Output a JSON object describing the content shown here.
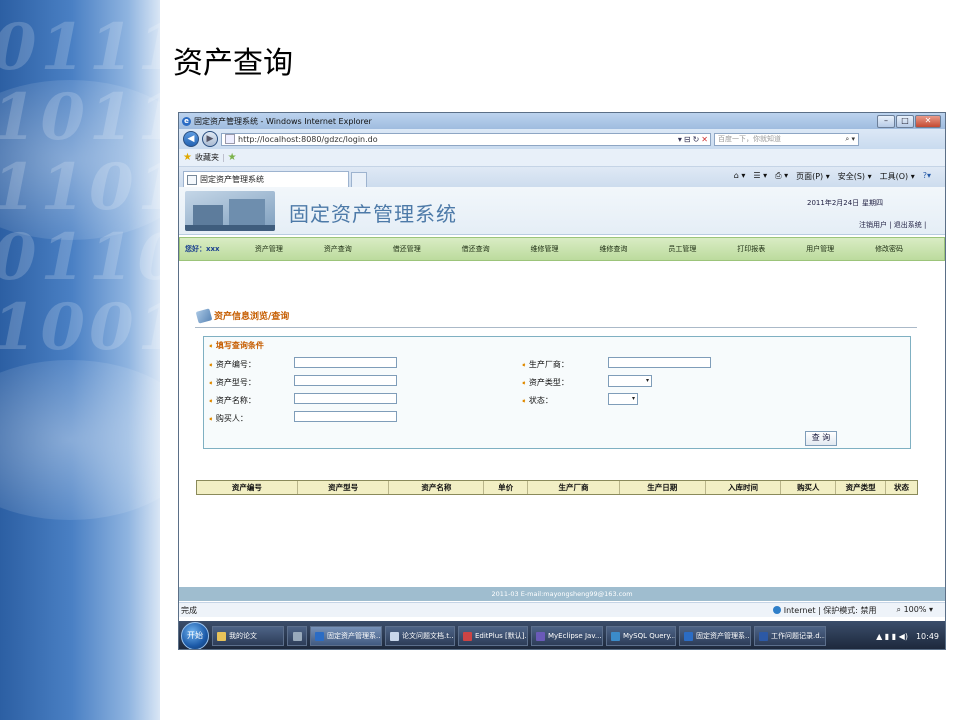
{
  "slide_title": "资产查询",
  "browser": {
    "window_title": "固定资产管理系统 - Windows Internet Explorer",
    "address": "http://localhost:8080/gdzc/login.do",
    "search_placeholder": "百度一下，你就知道",
    "favorites_label": "收藏夹",
    "tab_label": "固定资产管理系统",
    "command_bar": [
      "页面(P) ▾",
      "安全(S) ▾",
      "工具(O) ▾"
    ],
    "status_left": "完成",
    "status_zone": "Internet | 保护模式: 禁用",
    "zoom": "100%"
  },
  "app": {
    "title": "固定资产管理系统",
    "date": "2011年2月24日",
    "weekday": "星期四",
    "top_links": "注销用户 | 退出系统 |",
    "welcome": "您好：xxx",
    "menu": [
      "资产管理",
      "资产查询",
      "借还管理",
      "借还查询",
      "维修管理",
      "维修查询",
      "员工管理",
      "打印报表",
      "用户管理",
      "修改密码"
    ],
    "section_title": "资产信息浏览/查询",
    "query_title": "填写查询条件",
    "fields": {
      "asset_no": "资产编号：",
      "asset_model": "资产型号：",
      "asset_name": "资产名称：",
      "buyer": "购买人：",
      "manufacturer": "生产厂商：",
      "asset_type": "资产类型：",
      "status": "状态："
    },
    "query_button": "查 询",
    "table_headers": [
      "资产编号",
      "资产型号",
      "资产名称",
      "单价",
      "生产厂商",
      "生产日期",
      "入库时间",
      "购买人",
      "资产类型",
      "状态"
    ],
    "footer": "2011-03 E-mail:mayongsheng99@163.com"
  },
  "taskbar": {
    "start": "开始",
    "items": [
      "我的论文",
      "固定资产管理系...",
      "论文问题文档.t...",
      "EditPlus [默认]...",
      "MyEclipse Jav...",
      "MySQL Query...",
      "固定资产管理系...",
      "工作问题记录.d..."
    ],
    "clock": "10:49"
  }
}
